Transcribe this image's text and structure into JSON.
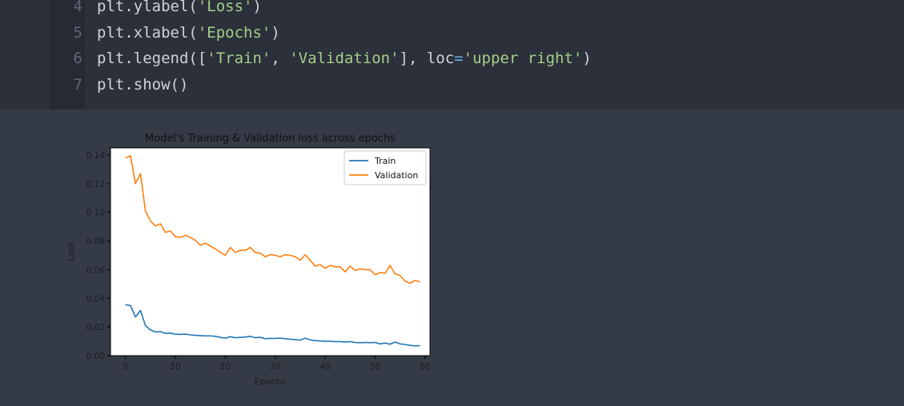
{
  "code": {
    "lines": [
      {
        "num": "4",
        "tokens": [
          {
            "t": "plt.ylabel(",
            "c": "id"
          },
          {
            "t": "'Loss'",
            "c": "str"
          },
          {
            "t": ")",
            "c": "id"
          }
        ]
      },
      {
        "num": "5",
        "tokens": [
          {
            "t": "plt.xlabel(",
            "c": "id"
          },
          {
            "t": "'Epochs'",
            "c": "str"
          },
          {
            "t": ")",
            "c": "id"
          }
        ]
      },
      {
        "num": "6",
        "tokens": [
          {
            "t": "plt.legend([",
            "c": "id"
          },
          {
            "t": "'Train'",
            "c": "str"
          },
          {
            "t": ", ",
            "c": "id"
          },
          {
            "t": "'Validation'",
            "c": "str"
          },
          {
            "t": "], loc",
            "c": "id"
          },
          {
            "t": "=",
            "c": "op"
          },
          {
            "t": "'upper right'",
            "c": "str"
          },
          {
            "t": ")",
            "c": "id"
          }
        ]
      },
      {
        "num": "7",
        "tokens": [
          {
            "t": "plt.show()",
            "c": "id"
          }
        ]
      }
    ]
  },
  "chart_data": {
    "type": "line",
    "title": "Model's Training & Validation loss across epochs",
    "xlabel": "Epochs",
    "ylabel": "Loss",
    "xlim": [
      -3,
      61
    ],
    "ylim": [
      0,
      0.145
    ],
    "xticks": [
      0,
      10,
      20,
      30,
      40,
      50,
      60
    ],
    "yticks": [
      0.0,
      0.02,
      0.04,
      0.06,
      0.08,
      0.1,
      0.12,
      0.14
    ],
    "ytick_labels": [
      "0.00",
      "0.02",
      "0.04",
      "0.06",
      "0.08",
      "0.10",
      "0.12",
      "0.14"
    ],
    "legend_position": "upper right",
    "grid": false,
    "series": [
      {
        "name": "Train",
        "color": "#1f77b4",
        "x": [
          0,
          1,
          2,
          3,
          4,
          5,
          6,
          7,
          8,
          9,
          10,
          11,
          12,
          13,
          14,
          15,
          16,
          17,
          18,
          19,
          20,
          21,
          22,
          23,
          24,
          25,
          26,
          27,
          28,
          29,
          30,
          31,
          32,
          33,
          34,
          35,
          36,
          37,
          38,
          39,
          40,
          41,
          42,
          43,
          44,
          45,
          46,
          47,
          48,
          49,
          50,
          51,
          52,
          53,
          54,
          55,
          56,
          57,
          58,
          59
        ],
        "y": [
          0.0355,
          0.035,
          0.027,
          0.0315,
          0.021,
          0.018,
          0.0165,
          0.0168,
          0.0155,
          0.0158,
          0.015,
          0.0148,
          0.015,
          0.0145,
          0.0142,
          0.014,
          0.0138,
          0.0138,
          0.0135,
          0.0128,
          0.0122,
          0.0132,
          0.0125,
          0.0128,
          0.013,
          0.0135,
          0.0125,
          0.0128,
          0.0118,
          0.012,
          0.012,
          0.0122,
          0.0118,
          0.0115,
          0.0112,
          0.0108,
          0.0122,
          0.011,
          0.0105,
          0.0103,
          0.01,
          0.01,
          0.0098,
          0.0098,
          0.0095,
          0.0098,
          0.0092,
          0.009,
          0.0092,
          0.009,
          0.0092,
          0.0082,
          0.0088,
          0.008,
          0.0095,
          0.0082,
          0.0078,
          0.0072,
          0.0068,
          0.007
        ]
      },
      {
        "name": "Validation",
        "color": "#ff7f0e",
        "x": [
          0,
          1,
          2,
          3,
          4,
          5,
          6,
          7,
          8,
          9,
          10,
          11,
          12,
          13,
          14,
          15,
          16,
          17,
          18,
          19,
          20,
          21,
          22,
          23,
          24,
          25,
          26,
          27,
          28,
          29,
          30,
          31,
          32,
          33,
          34,
          35,
          36,
          37,
          38,
          39,
          40,
          41,
          42,
          43,
          44,
          45,
          46,
          47,
          48,
          49,
          50,
          51,
          52,
          53,
          54,
          55,
          56,
          57,
          58,
          59
        ],
        "y": [
          0.138,
          0.1395,
          0.12,
          0.127,
          0.101,
          0.094,
          0.0905,
          0.092,
          0.086,
          0.087,
          0.083,
          0.0825,
          0.084,
          0.0825,
          0.0805,
          0.077,
          0.0785,
          0.0765,
          0.0745,
          0.072,
          0.07,
          0.0755,
          0.072,
          0.0735,
          0.0735,
          0.0755,
          0.072,
          0.0715,
          0.069,
          0.0705,
          0.07,
          0.069,
          0.0705,
          0.07,
          0.069,
          0.0665,
          0.0705,
          0.0665,
          0.0625,
          0.0635,
          0.061,
          0.063,
          0.062,
          0.062,
          0.0585,
          0.0625,
          0.0595,
          0.0605,
          0.06,
          0.06,
          0.0565,
          0.058,
          0.0575,
          0.063,
          0.057,
          0.056,
          0.052,
          0.0505,
          0.0525,
          0.0515
        ]
      }
    ]
  }
}
